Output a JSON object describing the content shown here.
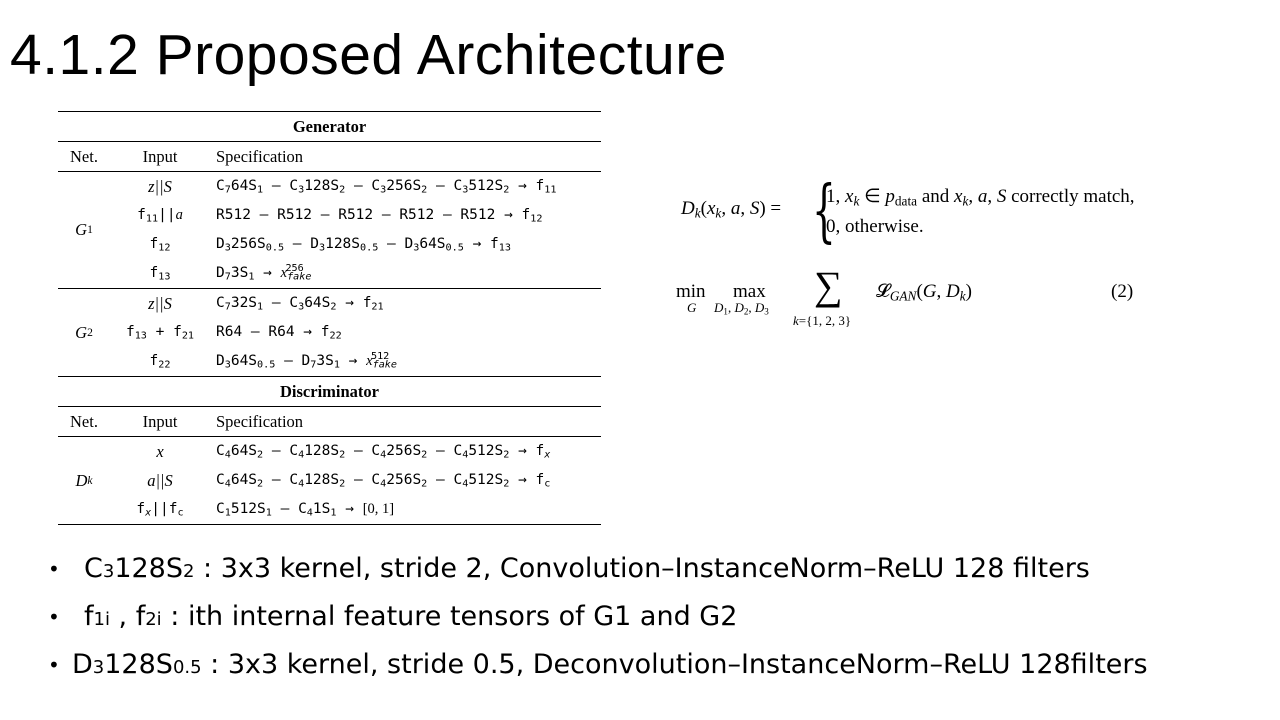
{
  "title": "4.1.2 Proposed Architecture",
  "table": {
    "generator_header": "Generator",
    "discriminator_header": "Discriminator",
    "col_net": "Net.",
    "col_input": "Input",
    "col_spec": "Specification"
  },
  "equations": {
    "dk_lhs": "D",
    "dk_case1": "1, x",
    "dk_case1_tail": "and x",
    "dk_case1_end": ", a, S correctly match,",
    "dk_case2": "0,  otherwise.",
    "obj_number": "(2)"
  },
  "bullets": {
    "b1_tail": " : 3x3 kernel, stride 2, Convolution–InstanceNorm–ReLU 128 filters",
    "b2_tail": " : ith internal feature tensors of G1 and G2",
    "b3_tail": " : 3x3 kernel, stride 0.5, Deconvolution–InstanceNorm–ReLU 128filters"
  }
}
